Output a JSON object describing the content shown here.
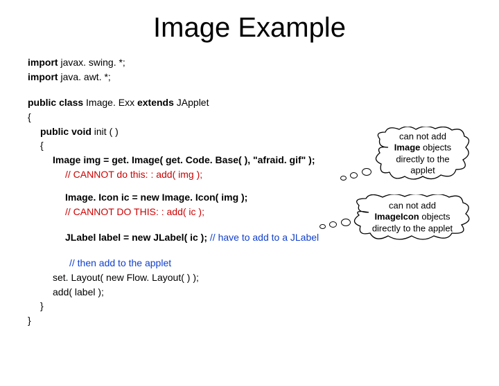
{
  "title": "Image Example",
  "code": {
    "import1_kw": "import",
    "import1_rest": " javax. swing. *;",
    "import2_kw": "import",
    "import2_rest": " java. awt. *;",
    "classdecl_1": "public class ",
    "classdecl_2": "Image. Exx ",
    "classdecl_3": "extends ",
    "classdecl_4": "JApplet",
    "open1": "{",
    "initdecl_1": "public void",
    "initdecl_2": "  init ( )",
    "open2": "{",
    "imgline": "Image img = get. Image( get. Code. Base( ), \"afraid. gif\" );",
    "cannot1": "// CANNOT do this: :   add( img );",
    "iconline": "Image. Icon ic = new Image. Icon( img );",
    "cannot2": "// CANNOT DO THIS: :   add( ic );",
    "labelline": "JLabel label = new JLabel( ic );",
    "labelcomment": "   // have to add to a JLabel",
    "thenadd": "// then add to the applet",
    "setlayout": "set. Layout( new Flow. Layout( ) );",
    "addlabel": "add( label );",
    "close2": "}",
    "close1": "}"
  },
  "bubble1": {
    "line1": "can not add",
    "line2_b": "Image",
    "line2_r": " objects",
    "line3": "directly to the",
    "line4": "applet"
  },
  "bubble2": {
    "line1": "can not add",
    "line2_b": "ImageIcon",
    "line2_r": " objects",
    "line3": "directly to the applet"
  }
}
